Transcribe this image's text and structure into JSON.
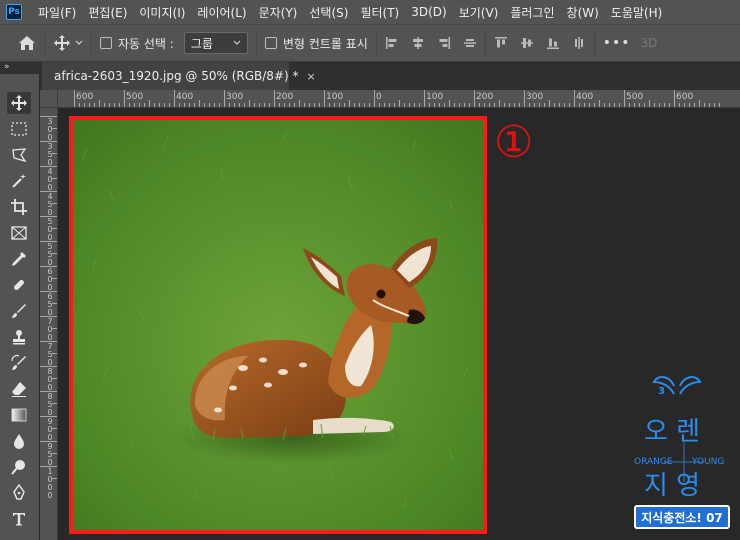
{
  "app": {
    "logo": "Ps"
  },
  "menu": [
    "파일(F)",
    "편집(E)",
    "이미지(I)",
    "레이어(L)",
    "문자(Y)",
    "선택(S)",
    "필터(T)",
    "3D(D)",
    "보기(V)",
    "플러그인",
    "창(W)",
    "도움말(H)"
  ],
  "options": {
    "auto_select_label": "자동 선택 :",
    "group_value": "그룹",
    "transform_label": "변형 컨트롤 표시",
    "more": "•••",
    "label_3d": "3D"
  },
  "toolbar": {
    "collapse": "»"
  },
  "document": {
    "tab_title": "africa-2603_1920.jpg @ 50% (RGB/8#) *",
    "close": "×"
  },
  "rulers": {
    "horizontal": [
      "600",
      "500",
      "400",
      "300",
      "200",
      "100",
      "0",
      "100",
      "200",
      "300",
      "400",
      "500",
      "600"
    ],
    "vertical": [
      "300",
      "350",
      "400",
      "450",
      "500",
      "550",
      "600",
      "650",
      "700",
      "750",
      "800",
      "850",
      "900",
      "950",
      "1000"
    ]
  },
  "canvas": {
    "annotation": "①",
    "annotation_color": "#e01010",
    "frame_color": "#ff1a1a"
  },
  "watermark": {
    "top_text": "오 렌",
    "middle_left": "ORANGE",
    "middle_right": "YOUNG",
    "bottom_text": "지 영",
    "badge": "지식충전소! 07"
  },
  "colors": {
    "accent": "#31a8ff",
    "chrome": "#535353",
    "workspace": "#282828"
  }
}
